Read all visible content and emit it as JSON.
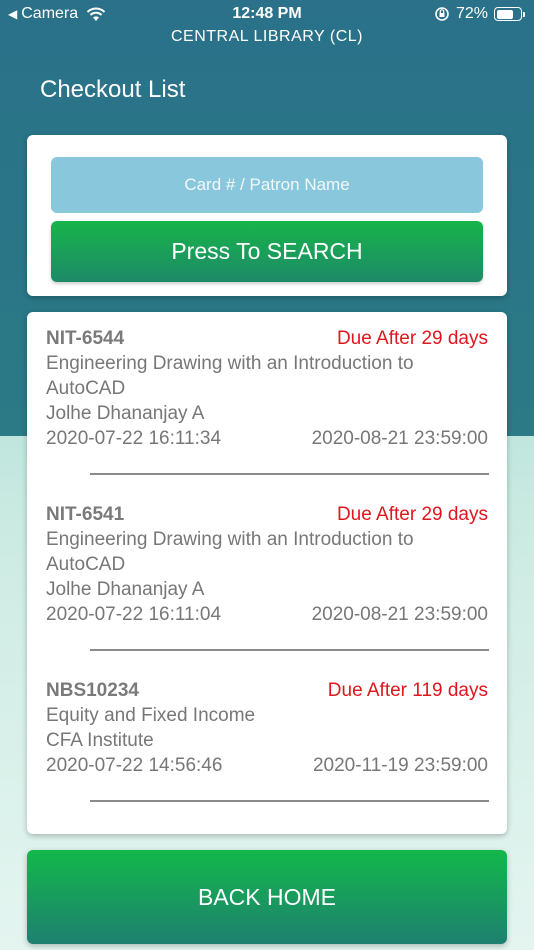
{
  "status_bar": {
    "back_app": "Camera",
    "time": "12:48 PM",
    "battery": "72%",
    "battery_level": 0.72
  },
  "header": {
    "library": "CENTRAL LIBRARY (CL)",
    "title": "Checkout List"
  },
  "search": {
    "placeholder": "Card # / Patron Name",
    "button_label": "Press To SEARCH"
  },
  "checkouts": [
    {
      "code": "NIT-6544",
      "due": "Due After 29 days",
      "title_line1": "Engineering Drawing with an Introduction to",
      "title_line2": "AutoCAD",
      "author": "Jolhe  Dhananjay A",
      "issued": "2020-07-22 16:11:34",
      "due_date": "2020-08-21 23:59:00"
    },
    {
      "code": "NIT-6541",
      "due": "Due After 29 days",
      "title_line1": "Engineering Drawing with an Introduction to",
      "title_line2": "AutoCAD",
      "author": "Jolhe  Dhananjay A",
      "issued": "2020-07-22 16:11:04",
      "due_date": "2020-08-21 23:59:00"
    },
    {
      "code": "NBS10234",
      "due": "Due After 119 days",
      "title_line1": "Equity and Fixed Income",
      "author": "CFA Institute",
      "issued": "2020-07-22 14:56:46",
      "due_date": "2020-11-19 23:59:00"
    }
  ],
  "footer": {
    "back_label": "BACK HOME"
  },
  "colors": {
    "header_bg": "#2a7189",
    "due_red": "#e0161d",
    "button_green": "#17b44a",
    "input_blue": "#89c7dc"
  }
}
